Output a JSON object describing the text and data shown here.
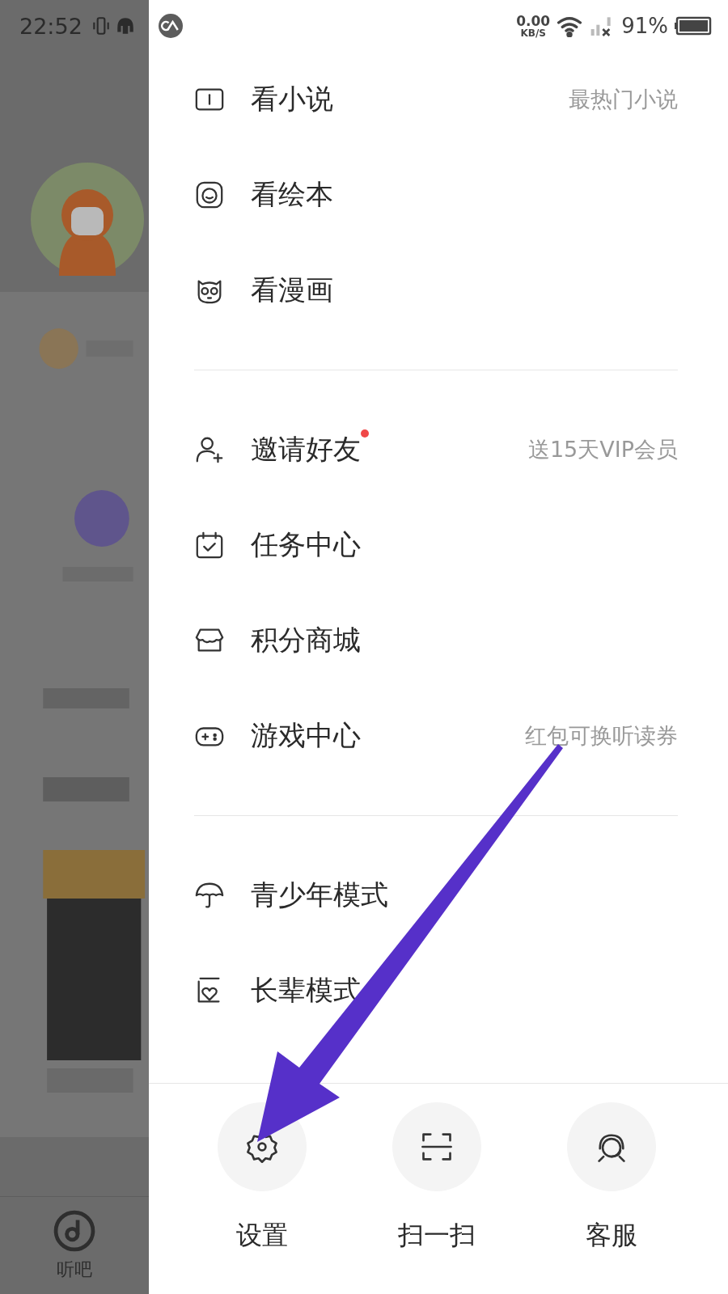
{
  "status_bar": {
    "time": "22:52",
    "network_speed": "0.00",
    "network_unit": "KB/S",
    "battery": "91%"
  },
  "background_page": {
    "tab_label": "听吧"
  },
  "drawer": {
    "sections": [
      [
        {
          "kind": "book",
          "label": "看小说",
          "hint": "最热门小说",
          "badge": false
        },
        {
          "kind": "face",
          "label": "看绘本",
          "badge": false
        },
        {
          "kind": "owl",
          "label": "看漫画",
          "badge": false
        }
      ],
      [
        {
          "kind": "user-add",
          "label": "邀请好友",
          "hint": "送15天VIP会员",
          "badge": true
        },
        {
          "kind": "calendar",
          "label": "任务中心",
          "badge": false
        },
        {
          "kind": "shop",
          "label": "积分商城",
          "badge": false
        },
        {
          "kind": "gamepad",
          "label": "游戏中心",
          "hint": "红包可换听读券",
          "badge": false
        }
      ],
      [
        {
          "kind": "umbrella",
          "label": "青少年模式",
          "badge": false
        },
        {
          "kind": "heart",
          "label": "长辈模式",
          "badge": false
        }
      ]
    ]
  },
  "bottom_actions": [
    {
      "kind": "gear",
      "label": "设置"
    },
    {
      "kind": "scan",
      "label": "扫一扫"
    },
    {
      "kind": "headset",
      "label": "客服"
    }
  ]
}
